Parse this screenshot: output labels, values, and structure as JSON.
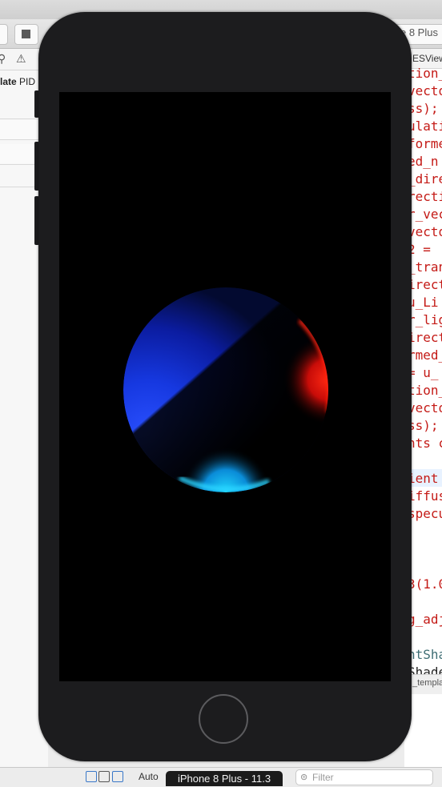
{
  "xcode": {
    "scheme_destination": "e 8 Plus",
    "template_label_bold": "late",
    "template_label_rest": " PID",
    "jump_bar_file": "ESView",
    "bottom_tab_label": "_templa",
    "auto_label": "Auto",
    "filter_placeholder": "Filter",
    "code_lines": [
      "tion_",
      "vecto",
      "ss);",
      "ulati",
      "forme",
      "ed_n",
      "_dire",
      "recti",
      "r_vec",
      "vecto",
      "2 =",
      "_tran",
      "irect",
      " u_Li",
      "r_lig",
      "irect",
      "rmed_",
      "= u_",
      "tion_",
      "vecto",
      "ss);",
      "nts c",
      "",
      "ient",
      "iffus",
      "specu",
      "",
      "",
      "",
      "3(1.0",
      "",
      "g_adj",
      "",
      "ntSha",
      "Shade"
    ]
  },
  "simulator": {
    "device_label": "iPhone 8 Plus - 11.3"
  },
  "colors": {
    "code_red": "#c41a16",
    "device_body": "#1c1c1e",
    "sphere_diffuse": "#1a3cff",
    "sphere_rim_red": "#ff1a10",
    "sphere_rim_cyan": "#18c8ff"
  }
}
